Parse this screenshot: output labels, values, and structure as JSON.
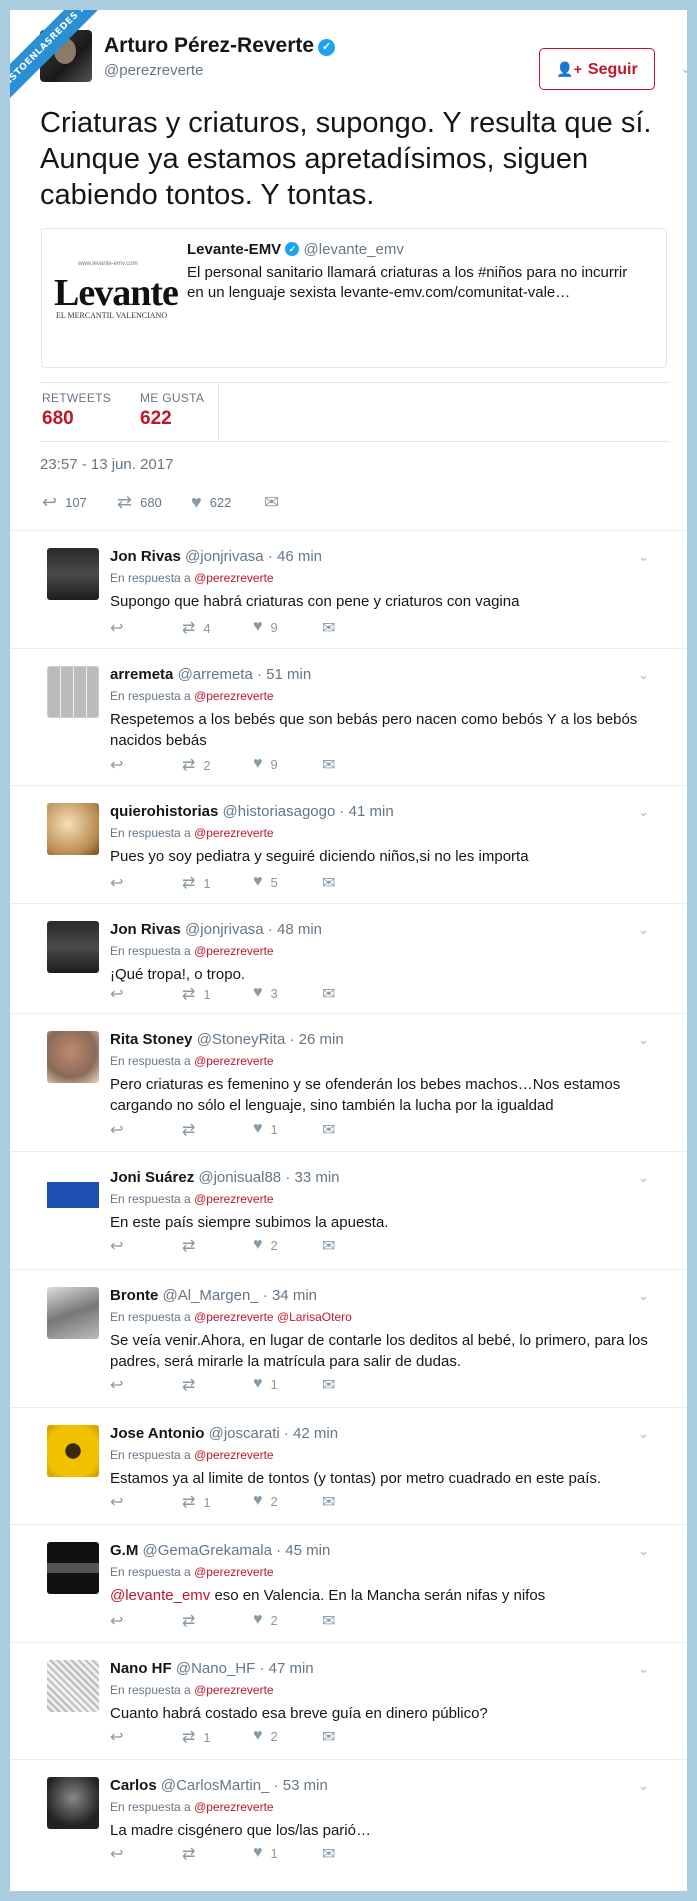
{
  "watermark": "VISTOENLASREDES .com",
  "tweet": {
    "author_name": "Arturo Pérez-Reverte",
    "author_handle": "@perezreverte",
    "follow_label": "Seguir",
    "text": "Criaturas y criaturos, supongo. Y resulta que sí. Aunque ya estamos apretadísimos, siguen cabiendo tontos. Y tontas.",
    "quote": {
      "name": "Levante-EMV",
      "handle": "@levante_emv",
      "text": "El personal sanitario llamará criaturas a los #niños para no incurrir en un lenguaje sexista levante-emv.com/comunitat-vale…",
      "logo_text": "Levante",
      "logo_sub": "EL MERCANTIL VALENCIANO",
      "logo_top": "www.levante-emv.com"
    },
    "stats": {
      "retweets_label": "RETWEETS",
      "retweets": "680",
      "likes_label": "ME GUSTA",
      "likes": "622"
    },
    "timestamp": "23:57 - 13 jun. 2017",
    "actions": {
      "replies": "107",
      "retweets": "680",
      "likes": "622"
    }
  },
  "colors": {
    "accent": "#c0162b",
    "verified": "#1da1f2",
    "background": "#a9ccdf"
  },
  "icons": {
    "reply": "reply-icon",
    "retweet": "retweet-icon",
    "like": "heart-icon",
    "dm": "message-icon"
  },
  "replies": [
    {
      "name": "Jon Rivas",
      "handle": "@jonjrivasa",
      "time": "46 min",
      "reply_to": "En respuesta a",
      "reply_to_handle": "@perezreverte",
      "text": "Supongo que habrá criaturas con pene y criaturos con vagina",
      "retweets": "4",
      "likes": "9"
    },
    {
      "name": "arremeta",
      "handle": "@arremeta",
      "time": "51 min",
      "reply_to": "En respuesta a",
      "reply_to_handle": "@perezreverte",
      "text": "Respetemos a los bebés que son bebás pero nacen como bebós Y a los bebós nacidos bebás",
      "retweets": "2",
      "likes": "9"
    },
    {
      "name": "quierohistorias",
      "handle": "@historiasagogo",
      "time": "41 min",
      "reply_to": "En respuesta a",
      "reply_to_handle": "@perezreverte",
      "text": "Pues yo soy pediatra y seguiré diciendo niños,si no les importa",
      "retweets": "1",
      "likes": "5"
    },
    {
      "name": "Jon Rivas",
      "handle": "@jonjrivasa",
      "time": "48 min",
      "reply_to": "En respuesta a",
      "reply_to_handle": "@perezreverte",
      "text": "¡Qué tropa!, o tropo.",
      "retweets": "1",
      "likes": "3"
    },
    {
      "name": "Rita Stoney",
      "handle": "@StoneyRita",
      "time": "26 min",
      "reply_to": "En respuesta a",
      "reply_to_handle": "@perezreverte",
      "text": "Pero criaturas es femenino y se ofenderán los bebes machos…Nos estamos cargando no sólo el lenguaje, sino también la lucha por la igualdad",
      "retweets": "",
      "likes": "1"
    },
    {
      "name": "Joni Suárez",
      "handle": "@jonisual88",
      "time": "33 min",
      "reply_to": "En respuesta a",
      "reply_to_handle": "@perezreverte",
      "text": "En este país siempre subimos la apuesta.",
      "retweets": "",
      "likes": "2"
    },
    {
      "name": "Bronte",
      "handle": "@Al_Margen_",
      "time": "34 min",
      "reply_to": "En respuesta a",
      "reply_to_handle": "@perezreverte @LarisaOtero",
      "text": "Se veía venir.Ahora, en lugar de contarle los deditos al bebé, lo primero, para los padres, será mirarle la matrícula para salir de dudas.",
      "retweets": "",
      "likes": "1"
    },
    {
      "name": "Jose Antonio",
      "handle": "@joscarati",
      "time": "42 min",
      "reply_to": "En respuesta a",
      "reply_to_handle": "@perezreverte",
      "text": "Estamos ya al limite de tontos (y tontas) por metro cuadrado en este país.",
      "retweets": "1",
      "likes": "2"
    },
    {
      "name": "G.M",
      "handle": "@GemaGrekamala",
      "time": "45 min",
      "reply_to": "En respuesta a",
      "reply_to_handle": "@perezreverte",
      "mention": "@levante_emv",
      "text": " eso en Valencia. En la Mancha serán nifas y nifos",
      "retweets": "",
      "likes": "2"
    },
    {
      "name": "Nano HF",
      "handle": "@Nano_HF",
      "time": "47 min",
      "reply_to": "En respuesta a",
      "reply_to_handle": "@perezreverte",
      "text": "Cuanto habrá costado esa breve guía en dinero público?",
      "retweets": "1",
      "likes": "2"
    },
    {
      "name": "Carlos",
      "handle": "@CarlosMartin_",
      "time": "53 min",
      "reply_to": "En respuesta a",
      "reply_to_handle": "@perezreverte",
      "text": "La madre cisgénero que los/las parió…",
      "retweets": "",
      "likes": "1"
    }
  ]
}
